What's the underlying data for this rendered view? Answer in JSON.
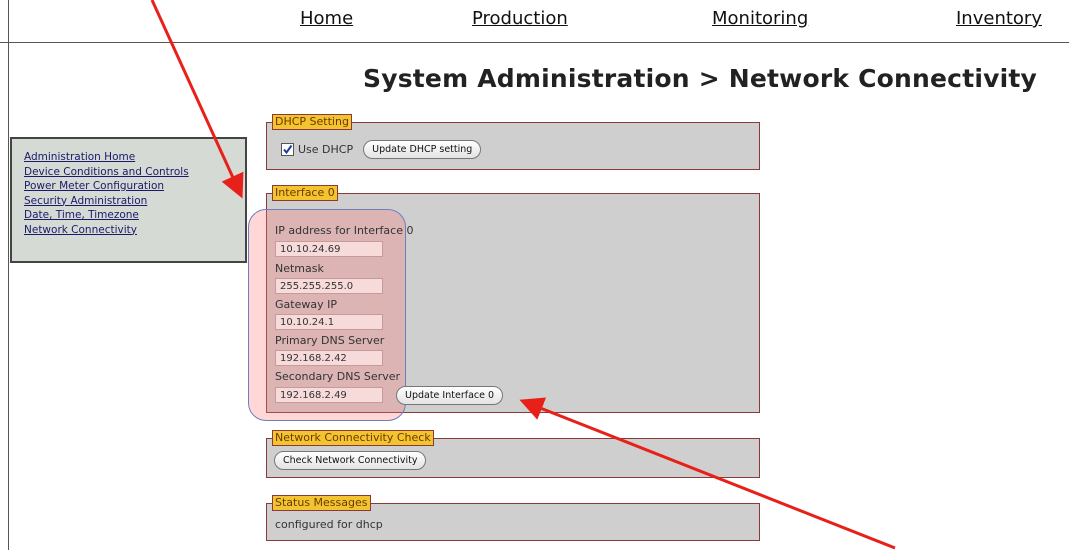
{
  "nav": {
    "home": "Home",
    "production": "Production",
    "monitoring": "Monitoring",
    "inventory": "Inventory"
  },
  "page_title": "System Administration > Network Connectivity",
  "sidebar": {
    "items": [
      {
        "label": "Administration Home"
      },
      {
        "label": "Device Conditions and Controls"
      },
      {
        "label": "Power Meter Configuration"
      },
      {
        "label": "Security Administration"
      },
      {
        "label": "Date, Time, Timezone"
      },
      {
        "label": "Network Connectivity"
      }
    ]
  },
  "dhcp": {
    "legend": "DHCP Setting",
    "checkbox_label": "Use DHCP",
    "checked": true,
    "update_button": "Update DHCP setting"
  },
  "interface0": {
    "legend": "Interface 0",
    "ip_label": "IP address for Interface 0",
    "ip_value": "10.10.24.69",
    "netmask_label": "Netmask",
    "netmask_value": "255.255.255.0",
    "gateway_label": "Gateway IP",
    "gateway_value": "10.10.24.1",
    "dns1_label": "Primary DNS Server",
    "dns1_value": "192.168.2.42",
    "dns2_label": "Secondary DNS Server",
    "dns2_value": "192.168.2.49",
    "update_button": "Update Interface 0"
  },
  "connectivity": {
    "legend": "Network Connectivity Check",
    "button": "Check Network Connectivity"
  },
  "status": {
    "legend": "Status Messages",
    "message": "configured for dhcp"
  },
  "colors": {
    "legend_bg": "#f4c430",
    "box_bg": "#cfcfcf",
    "sidebar_bg": "#d6dad4",
    "annotation_arrow": "#e8201a",
    "highlight_border": "#6b7fc0"
  },
  "icons": [
    "checkbox-icon",
    "annotation-arrow-icon"
  ]
}
